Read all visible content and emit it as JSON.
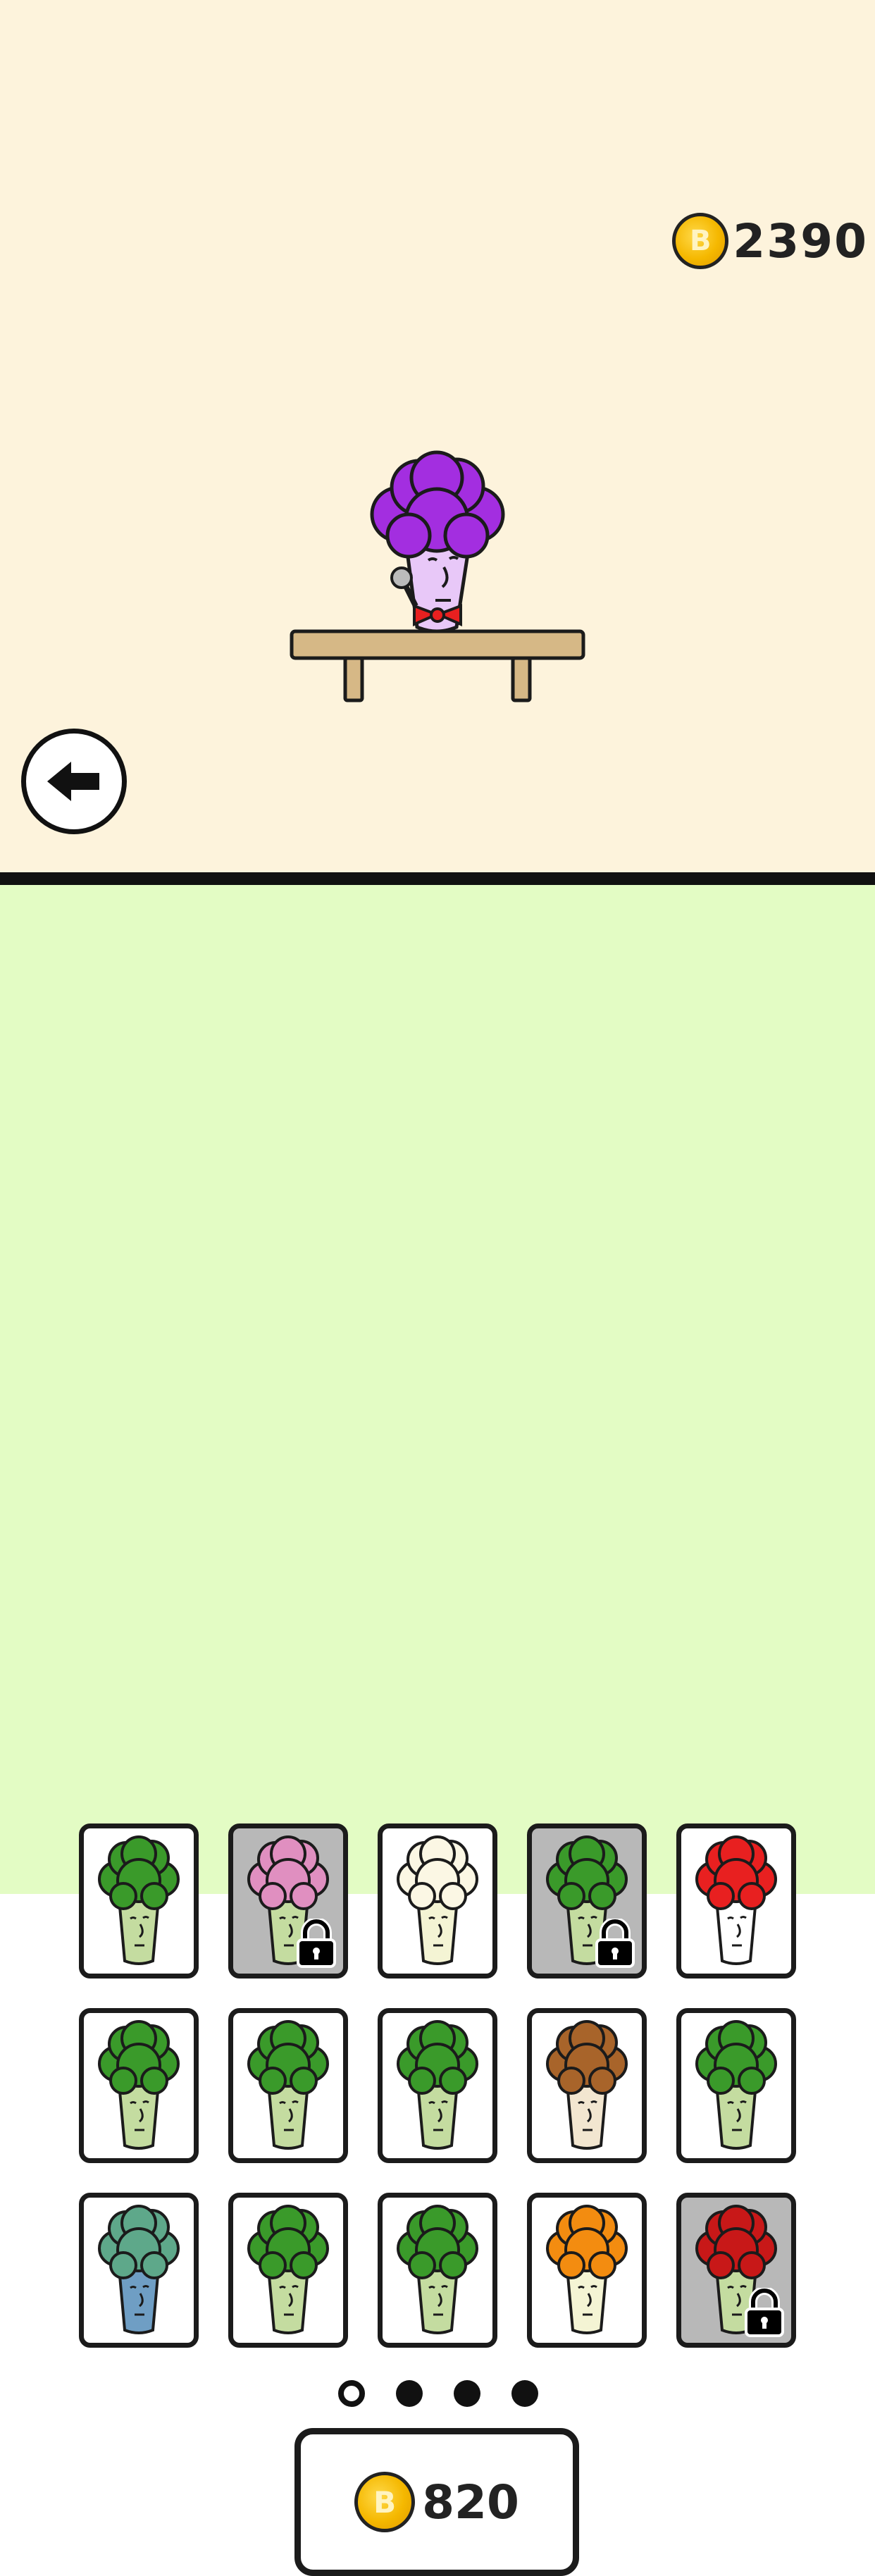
{
  "balance": {
    "coin_symbol": "B",
    "amount": "2390"
  },
  "stage": {
    "character": "purple-afro-comedian",
    "prop": "microphone",
    "accessory": "red-bow-tie"
  },
  "back_button": {
    "icon": "arrow-left-icon"
  },
  "skins": [
    {
      "id": "classic-broccoli",
      "hair": "#3a9a2a",
      "locked": false
    },
    {
      "id": "pink-hair-bow",
      "hair": "#e08fc0",
      "locked": true
    },
    {
      "id": "cauliflower",
      "hair": "#fbf7e4",
      "locked": false
    },
    {
      "id": "police-officer",
      "hair": "#3a9a2a",
      "locked": true
    },
    {
      "id": "clown",
      "hair": "#e82020",
      "locked": false
    },
    {
      "id": "chef",
      "hair": "#3a9a2a",
      "locked": false
    },
    {
      "id": "top-hat-gentleman",
      "hair": "#3a9a2a",
      "locked": false
    },
    {
      "id": "soccer-player",
      "hair": "#3a9a2a",
      "locked": false
    },
    {
      "id": "cat",
      "hair": "#a8642a",
      "locked": false
    },
    {
      "id": "cheerleader",
      "hair": "#3a9a2a",
      "locked": false
    },
    {
      "id": "zombie",
      "hair": "#5ea88a",
      "locked": false
    },
    {
      "id": "pirate",
      "hair": "#3a9a2a",
      "locked": false
    },
    {
      "id": "underwear",
      "hair": "#3a9a2a",
      "locked": false
    },
    {
      "id": "orange-afro",
      "hair": "#f38c10",
      "locked": false
    },
    {
      "id": "basketball-red-afro",
      "hair": "#c81818",
      "locked": true
    }
  ],
  "pagination": {
    "pages": 4,
    "current": 1
  },
  "buy_button": {
    "coin_symbol": "B",
    "price": "820"
  }
}
